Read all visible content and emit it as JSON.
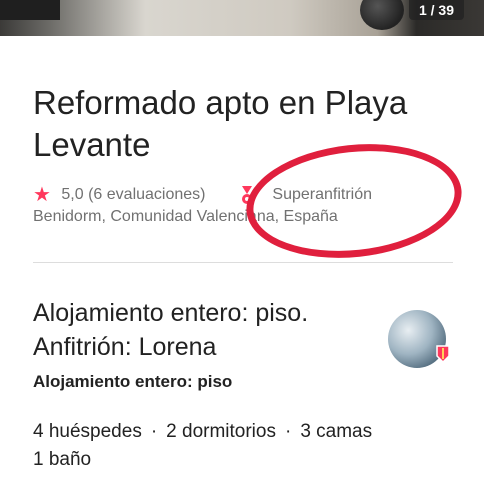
{
  "gallery": {
    "counter": "1 / 39"
  },
  "listing": {
    "title": "Reformado apto en Playa Levante",
    "rating": "5,0",
    "reviews": "(6 evaluaciones)",
    "superhost_label": "Superanfitrión",
    "location": "Benidorm, Comunidad Valenciana, España"
  },
  "host": {
    "title": "Alojamiento entero: piso. Anfitrión: Lorena",
    "subtitle": "Alojamiento entero: piso"
  },
  "details": {
    "guests": "4 huéspedes",
    "bedrooms": "2 dormitorios",
    "beds": "3 camas",
    "baths": "1 baño",
    "separator": "·"
  },
  "colors": {
    "accent": "#ff385c",
    "annotation": "#e01f3d",
    "muted": "#717171"
  },
  "icons": {
    "rating": "star-icon",
    "superhost": "superhost-badge-icon"
  }
}
